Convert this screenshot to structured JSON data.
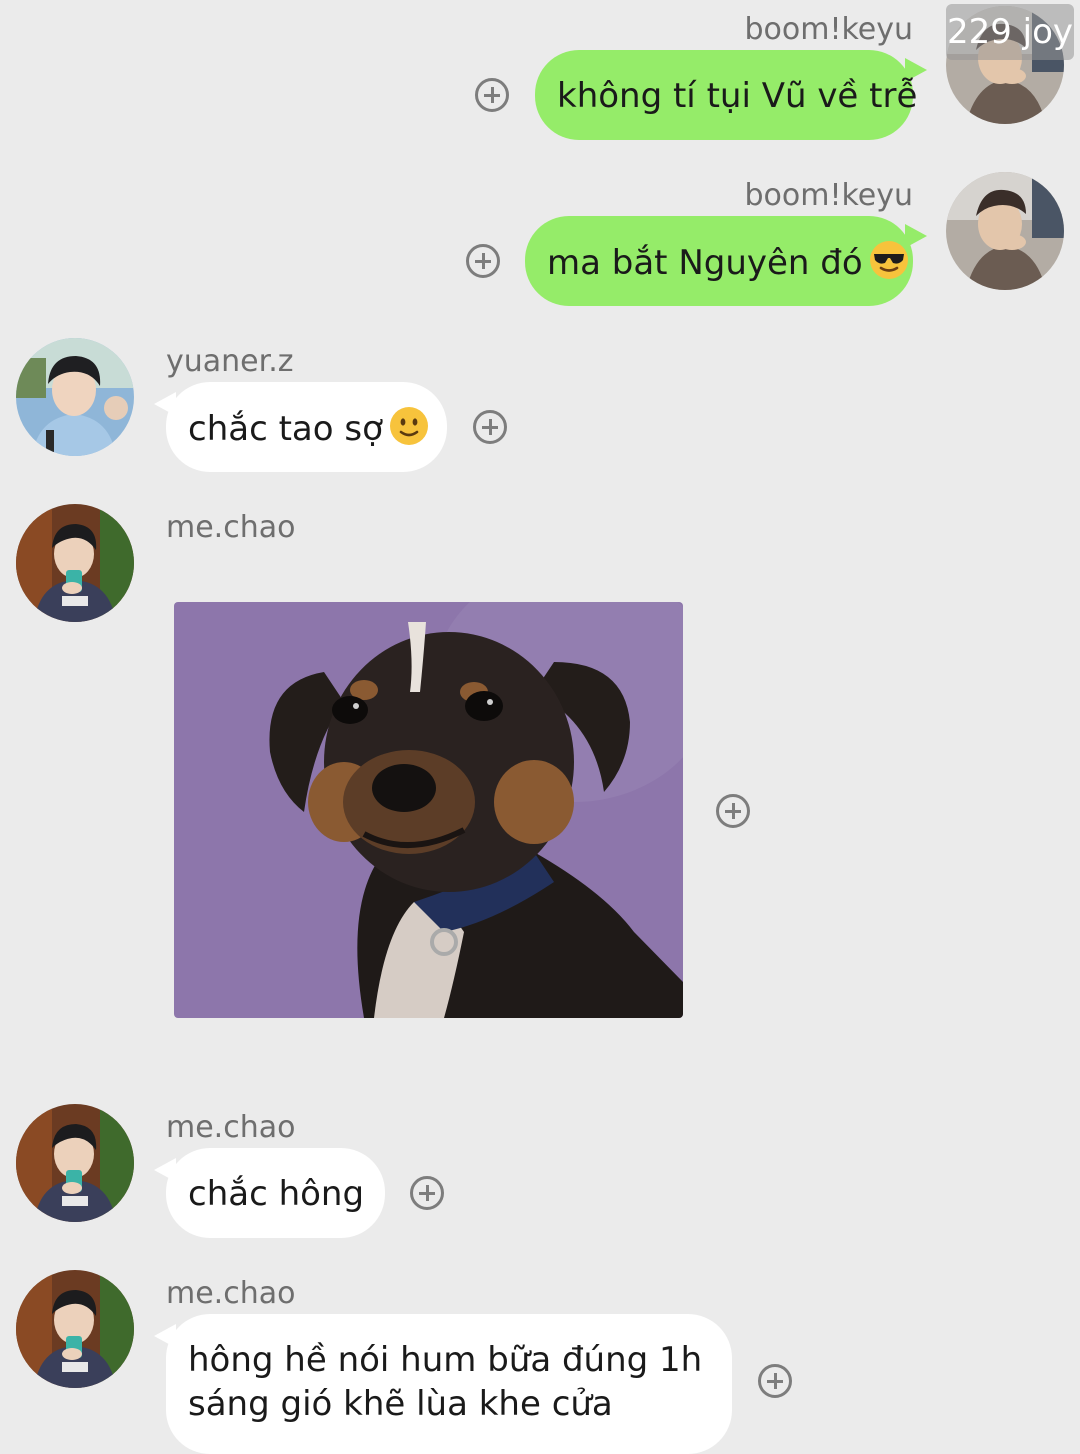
{
  "overlay": {
    "counter_text": "229 joy"
  },
  "messages": [
    {
      "sender": "boom!keyu",
      "side": "right",
      "type": "text",
      "text": "không tí tụi Vũ về trễ"
    },
    {
      "sender": "boom!keyu",
      "side": "right",
      "type": "text",
      "text": "ma bắt Nguyên đó",
      "emoji": "smiling-face-with-sunglasses"
    },
    {
      "sender": "yuaner.z",
      "side": "left",
      "type": "text",
      "text": "chắc tao sợ",
      "emoji": "slightly-smiling-face"
    },
    {
      "sender": "me.chao",
      "side": "left",
      "type": "image",
      "image": "smiling-dog-photo"
    },
    {
      "sender": "me.chao",
      "side": "left",
      "type": "text",
      "text": "chắc hông"
    },
    {
      "sender": "me.chao",
      "side": "left",
      "type": "text",
      "lines": [
        "hông hề nói hum bữa đúng 1h",
        "sáng gió khẽ lùa khe cửa"
      ]
    }
  ],
  "colors": {
    "background": "#ebebeb",
    "own_bubble": "#95ec69",
    "other_bubble": "#ffffff",
    "sender_name": "#6e6e6e",
    "add_icon": "#7d7d7d"
  },
  "icons": {
    "add_reaction": "plus-circle-icon"
  }
}
